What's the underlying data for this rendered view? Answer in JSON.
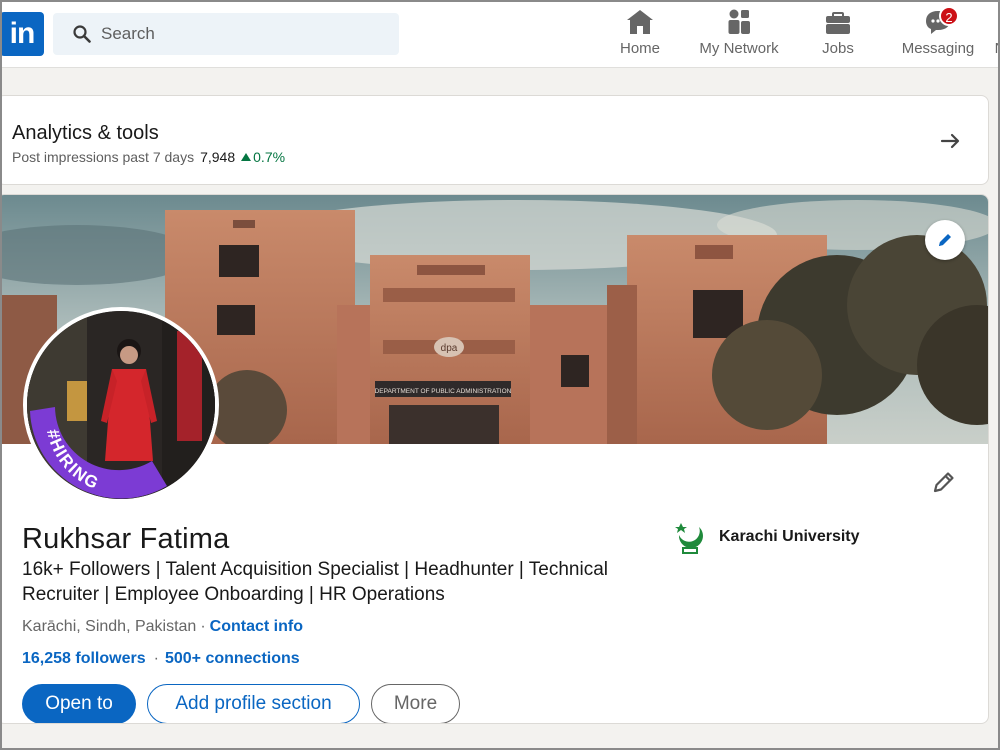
{
  "nav": {
    "search_placeholder": "Search",
    "items": [
      {
        "label": "Home",
        "icon": "home-icon"
      },
      {
        "label": "My Network",
        "icon": "people-icon"
      },
      {
        "label": "Jobs",
        "icon": "briefcase-icon"
      },
      {
        "label": "Messaging",
        "icon": "chat-icon",
        "badge": "2"
      },
      {
        "label": "N",
        "icon": "bell-icon"
      }
    ]
  },
  "analytics": {
    "title": "Analytics & tools",
    "subtitle": "Post impressions past 7 days",
    "count": "7,948",
    "delta": "0.7%"
  },
  "profile": {
    "banner_sign": "DEPARTMENT OF PUBLIC ADMINISTRATION",
    "banner_logo": "dpa",
    "avatar_badge": "#HIRING",
    "name": "Rukhsar Fatima",
    "headline": "16k+ Followers | Talent Acquisition Specialist | Headhunter | Technical Recruiter | Employee Onboarding | HR Operations",
    "location": "Karāchi, Sindh, Pakistan",
    "location_sep": "·",
    "contact_info": "Contact info",
    "followers": "16,258 followers",
    "stats_sep": "·",
    "connections": "500+ connections",
    "buttons": {
      "open_to": "Open to",
      "add_section": "Add profile section",
      "more": "More"
    },
    "education": "Karachi University"
  },
  "colors": {
    "brand": "#0a66c2",
    "positive": "#057642",
    "badge": "#cc1016",
    "hiring": "#7c3bd4"
  }
}
